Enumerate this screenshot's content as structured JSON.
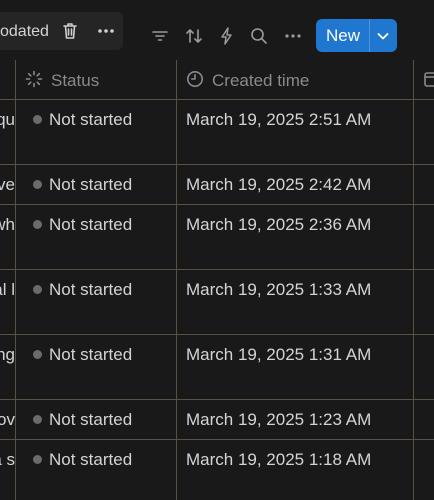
{
  "toolbar": {
    "bulk_label": "odated",
    "new_button_label": "New",
    "icons": [
      "trash-icon",
      "more-horizontal-icon",
      "filter-icon",
      "sort-icon",
      "automation-bolt-icon",
      "search-icon",
      "more-horizontal-icon",
      "chevron-down-icon"
    ]
  },
  "table": {
    "columns": [
      {
        "label": "Status",
        "icon": "status-spinner-icon"
      },
      {
        "label": "Created time",
        "icon": "clock-icon"
      }
    ],
    "rows": [
      {
        "title_fragment": "iqu",
        "status": "Not started",
        "created": "March 19, 2025 2:51 AM"
      },
      {
        "title_fragment": "ve",
        "status": "Not started",
        "created": "March 19, 2025 2:42 AM"
      },
      {
        "title_fragment": "wh",
        "status": "Not started",
        "created": "March 19, 2025 2:36 AM"
      },
      {
        "title_fragment": "al l",
        "status": "Not started",
        "created": "March 19, 2025 1:33 AM"
      },
      {
        "title_fragment": "ng",
        "status": "Not started",
        "created": "March 19, 2025 1:31 AM"
      },
      {
        "title_fragment": "lov",
        "status": "Not started",
        "created": "March 19, 2025 1:23 AM"
      },
      {
        "title_fragment": "a s",
        "status": "Not started",
        "created": "March 19, 2025 1:18 AM"
      }
    ]
  },
  "colors": {
    "background": "#191919",
    "accent": "#2077cf",
    "grid": "#5a5145",
    "status_dot": "#6b6b6b"
  }
}
